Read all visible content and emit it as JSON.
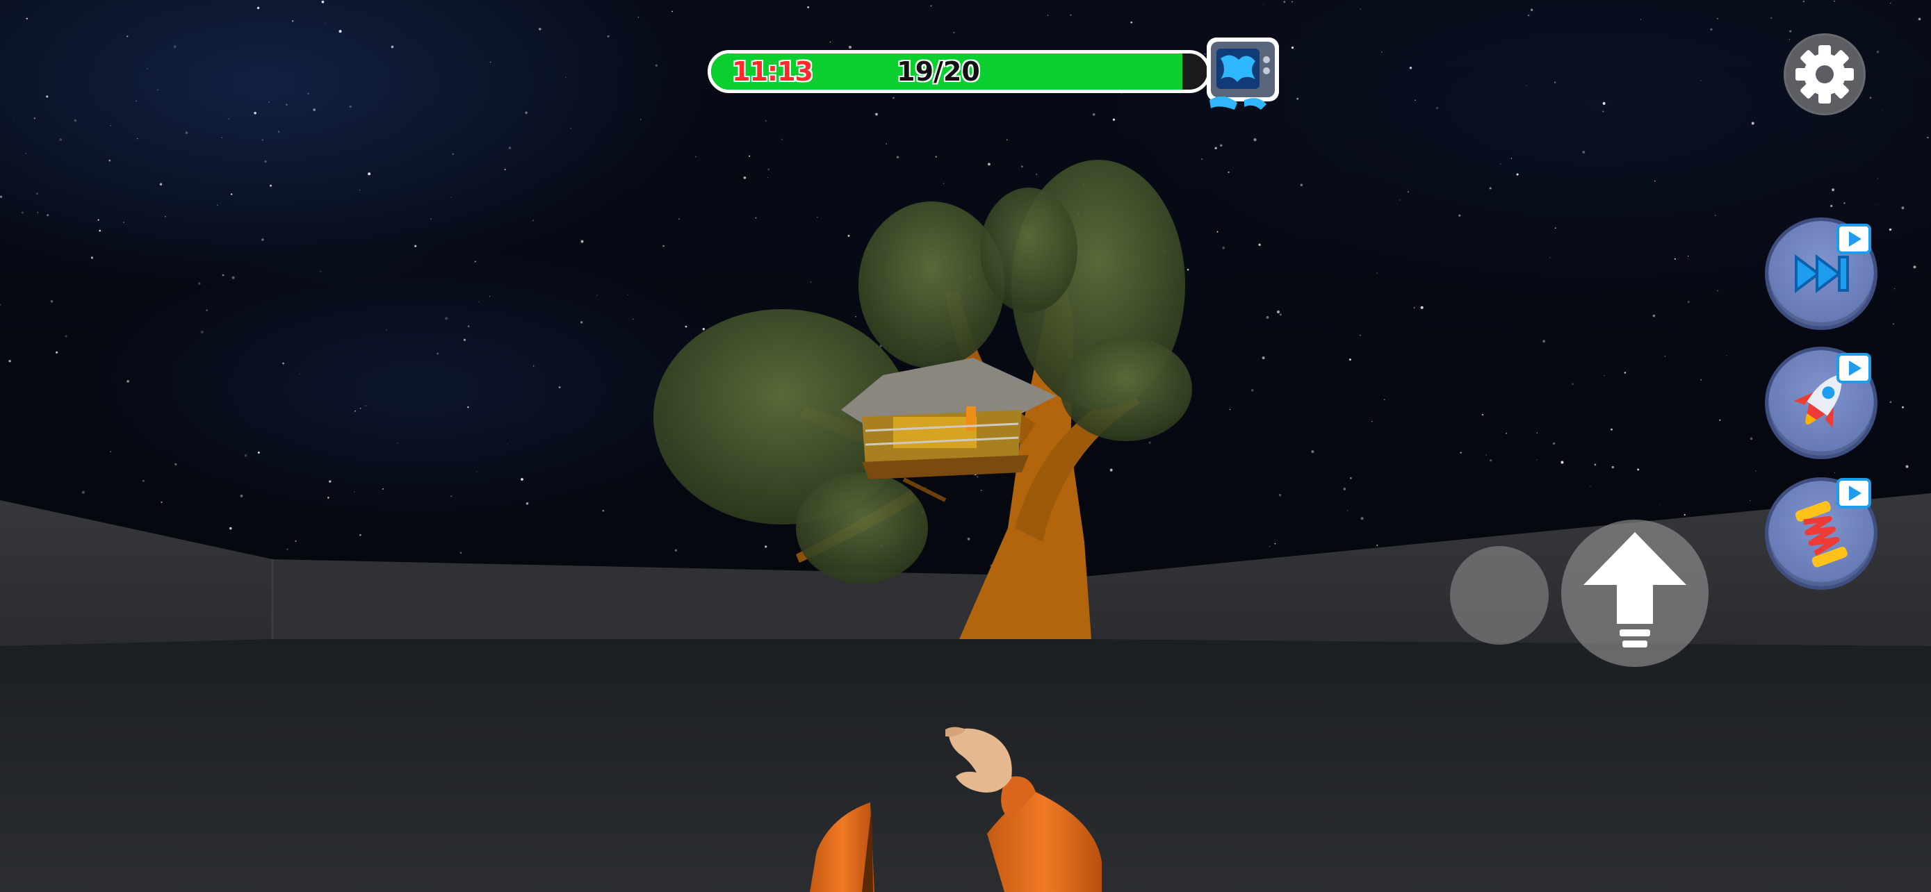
{
  "hud": {
    "timer_text": "11:13",
    "progress_text": "19/20",
    "progress_fraction": 0.95,
    "tv_icon": "tv-blue-reward-icon"
  },
  "controls": {
    "settings_icon": "gear-icon",
    "side_buttons": [
      {
        "icon": "fast-forward-icon",
        "badge": "video-ad-icon"
      },
      {
        "icon": "rocket-icon",
        "badge": "video-ad-icon"
      },
      {
        "icon": "spring-icon",
        "badge": "video-ad-icon"
      }
    ],
    "crouch_icon": "crouch-circle",
    "jump_icon": "up-arrow-icon"
  },
  "colors": {
    "bar_fill": "#0bcf2f",
    "timer_text": "#ff2a2a",
    "side_button": "#6f82bd",
    "settings_button": "#5d5e63"
  }
}
